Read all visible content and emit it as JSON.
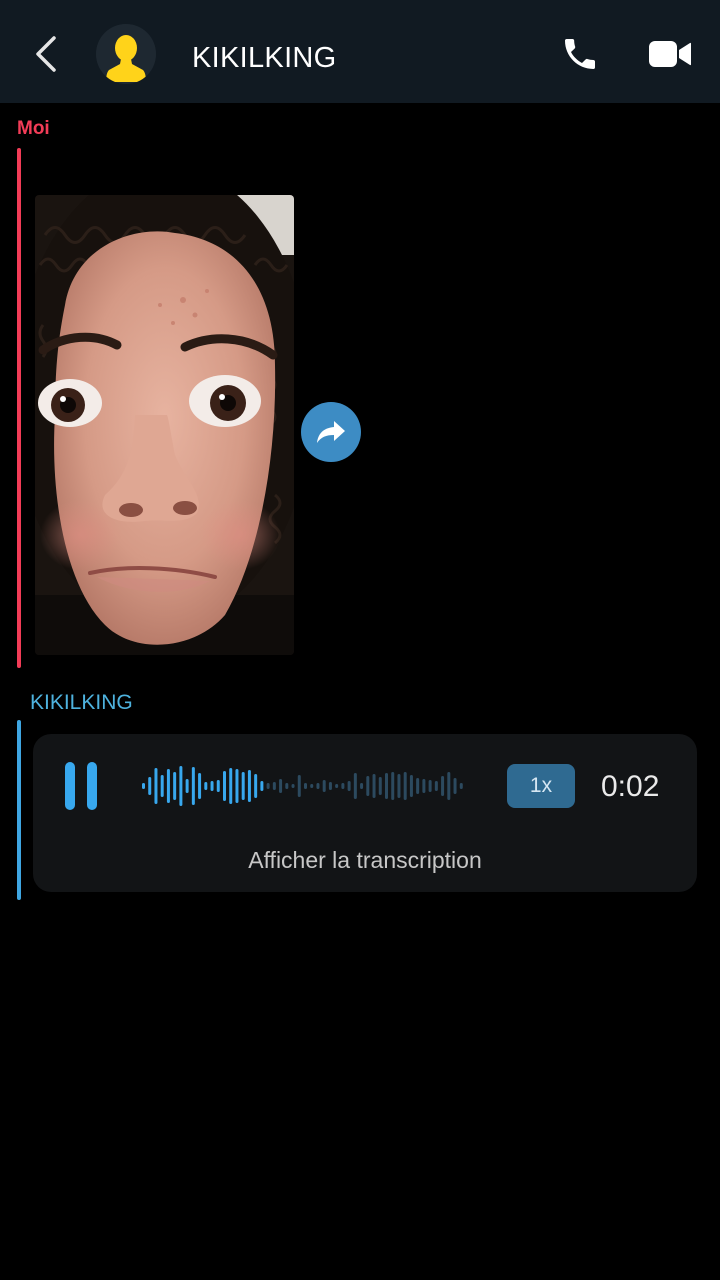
{
  "header": {
    "title": "KIKILKING",
    "icons": {
      "back": "chevron-left-icon",
      "avatar": "bitmoji-silhouette-icon",
      "call": "phone-icon",
      "video": "video-camera-icon"
    }
  },
  "messages": [
    {
      "sender": "Moi",
      "color": "#f23c57",
      "type": "snap-photo",
      "share_icon": "share-arrow-icon"
    },
    {
      "sender": "KIKILKING",
      "color": "#4eb2de",
      "type": "voice-note",
      "state": "playing",
      "speed": "1x",
      "duration": "0:02",
      "transcript_label": "Afficher la transcription",
      "progress": 0.38
    }
  ],
  "colors": {
    "header_bg": "#111a22",
    "me_accent": "#f23c57",
    "friend_accent": "#3fa6e2",
    "waveform_played": "#38a8ee",
    "waveform_unplayed": "#2c4a5f",
    "card_bg": "#121416"
  }
}
